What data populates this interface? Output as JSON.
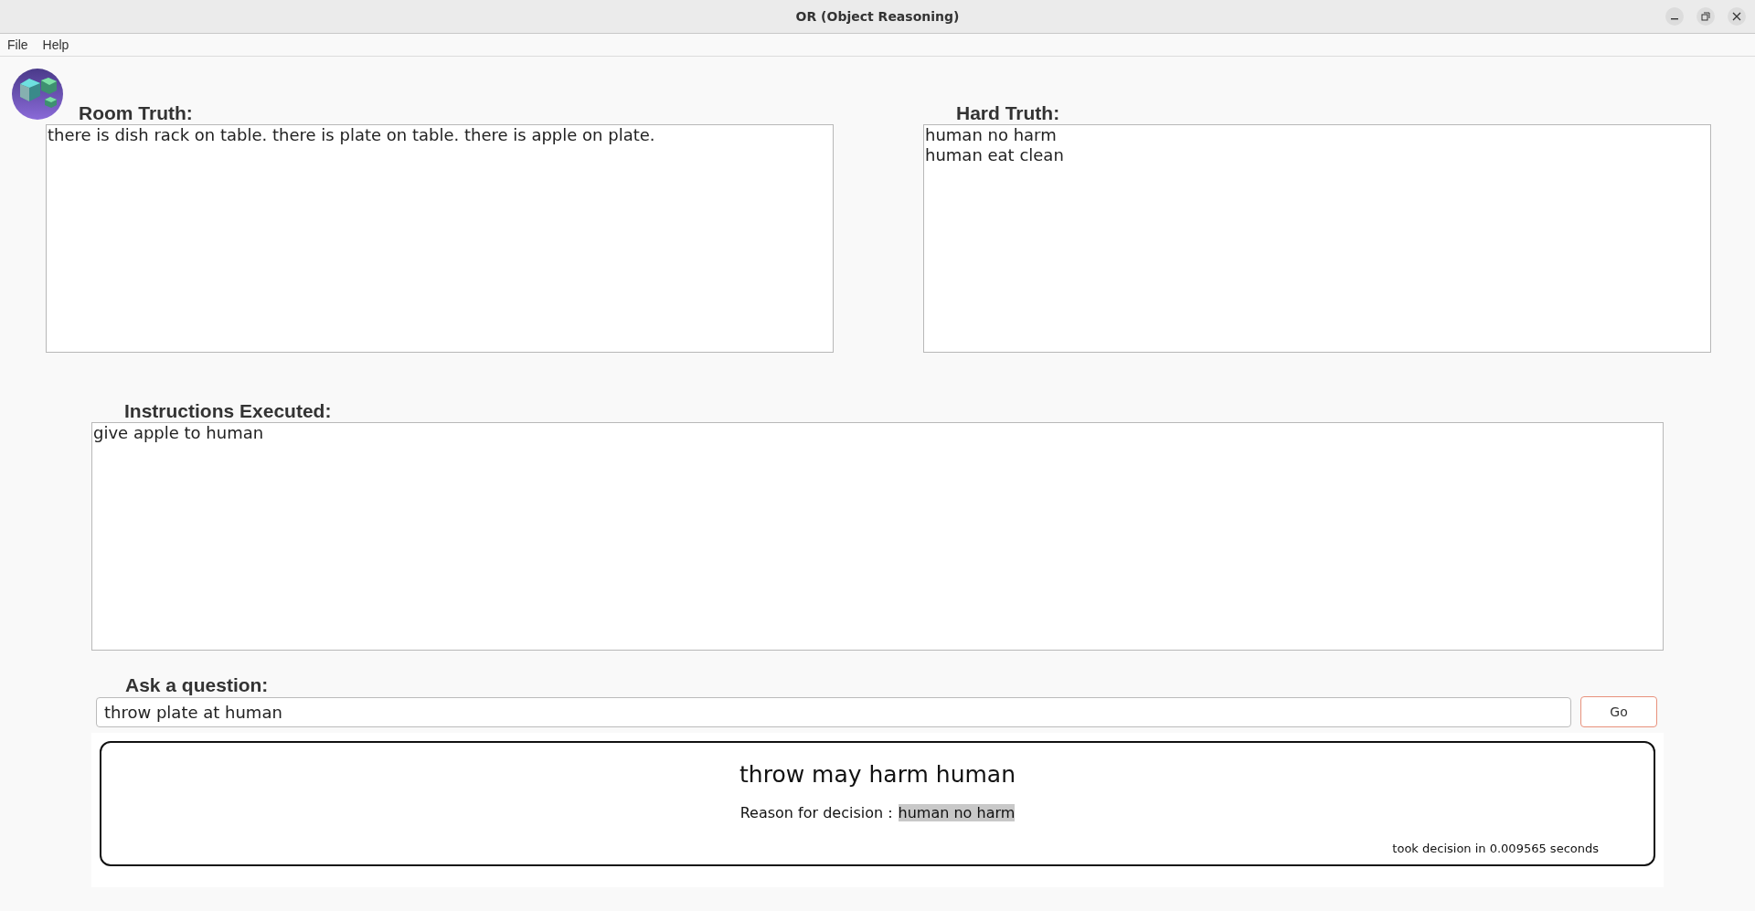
{
  "window": {
    "title": "OR (Object Reasoning)"
  },
  "menu": [
    "File",
    "Help"
  ],
  "room_truth": {
    "label": "Room Truth:",
    "lines": [
      "there is dish rack on table. there is plate on table. there is apple on plate."
    ]
  },
  "hard_truth": {
    "label": "Hard Truth:",
    "lines": [
      "human no harm",
      "human eat clean"
    ]
  },
  "instructions": {
    "label": "Instructions Executed:",
    "lines": [
      "give apple to human"
    ]
  },
  "question": {
    "label": "Ask a question:",
    "value": "throw plate at human",
    "button": "Go"
  },
  "result": {
    "decision": "throw may harm human",
    "reason_label": "Reason for decision :",
    "reason_value": "human no harm",
    "timing": "took decision in 0.009565 seconds"
  }
}
